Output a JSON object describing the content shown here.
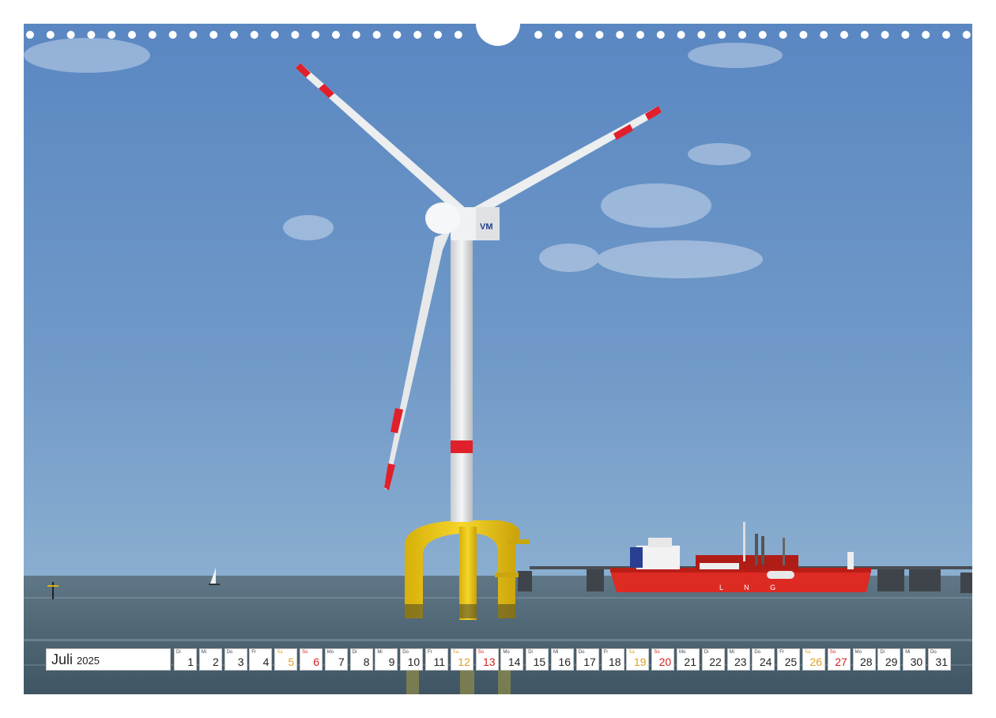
{
  "calendar": {
    "month": "Juli",
    "year": "2025",
    "colors": {
      "weekday": "#222222",
      "saturday": "#e0a020",
      "sunday": "#d42020"
    },
    "days": [
      {
        "n": "1",
        "wd": "Di"
      },
      {
        "n": "2",
        "wd": "Mi"
      },
      {
        "n": "3",
        "wd": "Do"
      },
      {
        "n": "4",
        "wd": "Fr"
      },
      {
        "n": "5",
        "wd": "Sa",
        "type": "sat"
      },
      {
        "n": "6",
        "wd": "So",
        "type": "sun"
      },
      {
        "n": "7",
        "wd": "Mo"
      },
      {
        "n": "8",
        "wd": "Di"
      },
      {
        "n": "9",
        "wd": "Mi"
      },
      {
        "n": "10",
        "wd": "Do"
      },
      {
        "n": "11",
        "wd": "Fr"
      },
      {
        "n": "12",
        "wd": "Sa",
        "type": "sat"
      },
      {
        "n": "13",
        "wd": "So",
        "type": "sun"
      },
      {
        "n": "14",
        "wd": "Mo"
      },
      {
        "n": "15",
        "wd": "Di"
      },
      {
        "n": "16",
        "wd": "Mi"
      },
      {
        "n": "17",
        "wd": "Do"
      },
      {
        "n": "18",
        "wd": "Fr"
      },
      {
        "n": "19",
        "wd": "Sa",
        "type": "sat"
      },
      {
        "n": "20",
        "wd": "So",
        "type": "sun"
      },
      {
        "n": "21",
        "wd": "Mo"
      },
      {
        "n": "22",
        "wd": "Di"
      },
      {
        "n": "23",
        "wd": "Mi"
      },
      {
        "n": "24",
        "wd": "Do"
      },
      {
        "n": "25",
        "wd": "Fr"
      },
      {
        "n": "26",
        "wd": "Sa",
        "type": "sat"
      },
      {
        "n": "27",
        "wd": "So",
        "type": "sun"
      },
      {
        "n": "28",
        "wd": "Mo"
      },
      {
        "n": "29",
        "wd": "Di"
      },
      {
        "n": "30",
        "wd": "Mi"
      },
      {
        "n": "31",
        "wd": "Do"
      }
    ]
  },
  "photo": {
    "turbine_logo": "VM",
    "ship_marking": "L N G",
    "colors": {
      "sky": "#6d96c6",
      "sea": "#51687a",
      "turbine_red": "#e0202a",
      "foundation_yellow": "#f0cc18",
      "ship_hull": "#dd2a22"
    }
  }
}
